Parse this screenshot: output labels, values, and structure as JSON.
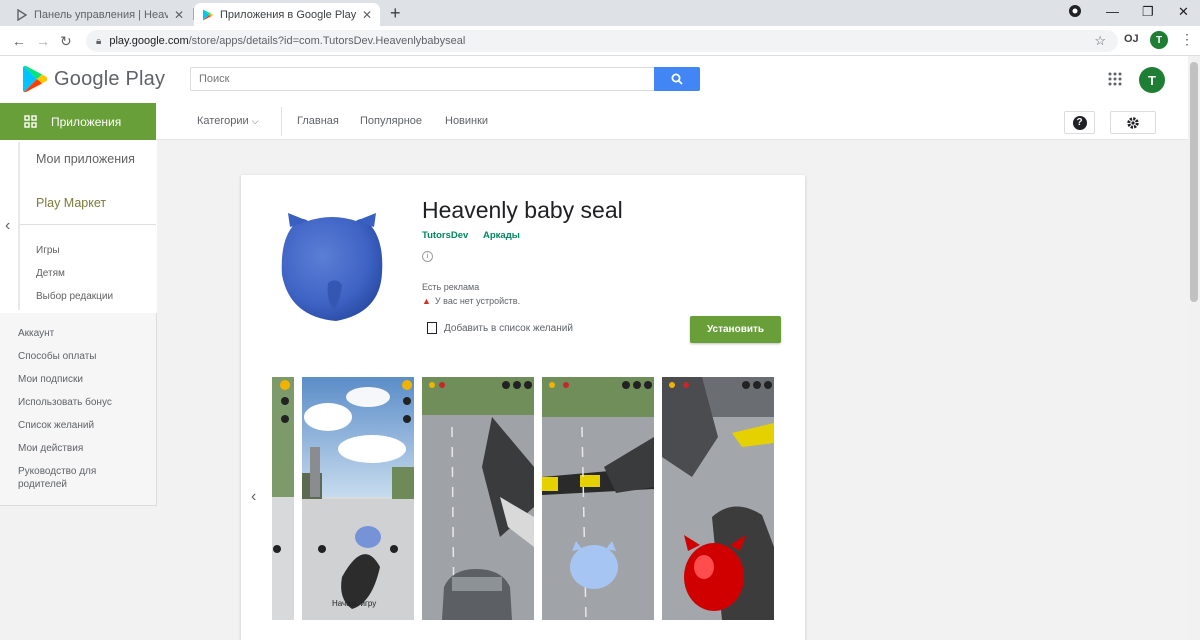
{
  "browser": {
    "tabs": [
      {
        "label": "Панель управления | Heavenly baby seal",
        "favicon": "play-console-icon"
      },
      {
        "label": "Приложения в Google Play – Heavenly baby seal",
        "favicon": "google-play-icon"
      }
    ],
    "url_host": "play.google.com",
    "url_path": "/store/apps/details?id=com.TutorsDev.Heavenlybabyseal",
    "account_initial": "T"
  },
  "header": {
    "logo_text": "Google Play",
    "search_placeholder": "Поиск",
    "account_initial": "T",
    "accent_color": "#4285f4"
  },
  "subnav": {
    "apps_label": "Приложения",
    "categories_label": "Категории",
    "top_charts_label": "Главная",
    "popular_label": "Популярное",
    "new_label": "Новинки"
  },
  "sidebar": {
    "my_apps": "Мои приложения",
    "store": "Play Маркет",
    "sub_items": [
      "Игры",
      "Детям",
      "Выбор редакции"
    ],
    "account_items": [
      "Аккаунт",
      "Способы оплаты",
      "Мои подписки",
      "Использовать бонус",
      "Список желаний",
      "Мои действия",
      "Руководство для родителей"
    ]
  },
  "app": {
    "title": "Heavenly baby seal",
    "developer": "TutorsDev",
    "category": "Аркады",
    "ads_note": "Есть реклама",
    "warning_note": "У вас нет устройств.",
    "wishlist_label": "Добавить в список желаний",
    "install_label": "Установить",
    "install_color": "#689f38",
    "screenshot_caption": "Начать игру"
  }
}
